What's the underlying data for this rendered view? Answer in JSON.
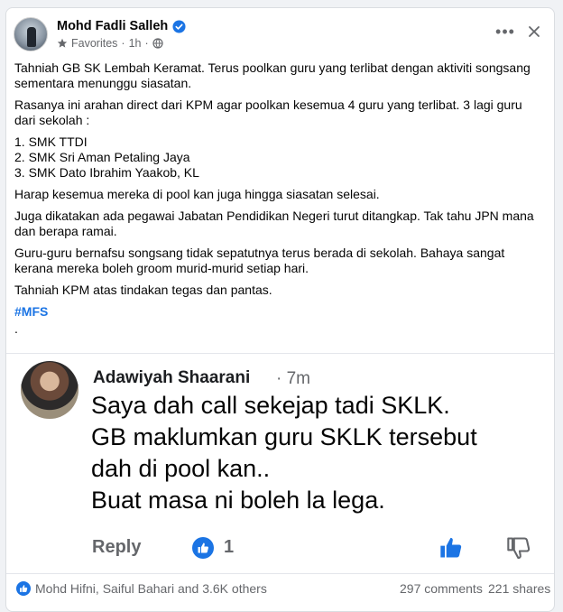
{
  "post": {
    "author": "Mohd Fadli Salleh",
    "audience": "Favorites",
    "time": "1h",
    "paragraphs": {
      "p1": "Tahniah GB SK Lembah Keramat. Terus poolkan guru yang terlibat dengan aktiviti songsang sementara menunggu siasatan.",
      "p2": "Rasanya ini arahan direct dari KPM agar poolkan kesemua 4 guru yang terlibat. 3 lagi guru dari sekolah :",
      "list1": "1. SMK TTDI",
      "list2": "2. SMK Sri Aman Petaling Jaya",
      "list3": "3. SMK Dato Ibrahim Yaakob, KL",
      "p3": "Harap kesemua mereka di pool kan juga hingga siasatan selesai.",
      "p4": "Juga dikatakan ada pegawai Jabatan Pendidikan Negeri turut ditangkap. Tak tahu JPN mana dan berapa ramai.",
      "p5": "Guru-guru bernafsu songsang tidak sepatutnya terus berada di sekolah. Bahaya sangat kerana mereka boleh groom murid-murid setiap hari.",
      "p6": "Tahniah KPM atas tindakan tegas dan pantas.",
      "hashtag": "#MFS",
      "dot": "."
    }
  },
  "comment_screenshot": {
    "name": "Adawiyah Shaarani",
    "time": "· 7m",
    "line1": "Saya dah call sekejap tadi SKLK.",
    "line2": "GB maklumkan guru SKLK tersebut",
    "line3": "dah di pool kan..",
    "line4": "Buat masa ni boleh la lega.",
    "reply_label": "Reply",
    "like_count": "1"
  },
  "footer": {
    "reactions": "Mohd Hifni, Saiful Bahari and 3.6K others",
    "comments": "297 comments",
    "shares": "221 shares"
  },
  "colors": {
    "accent": "#1b74e4",
    "muted": "#65676b",
    "text": "#050505"
  },
  "icons": {
    "verified": "verified-badge-icon",
    "favorites": "star-icon",
    "audience": "globe-icon",
    "more": "more-dots-icon",
    "close": "close-icon",
    "like": "thumbs-up-icon",
    "dislike": "thumbs-down-icon"
  }
}
